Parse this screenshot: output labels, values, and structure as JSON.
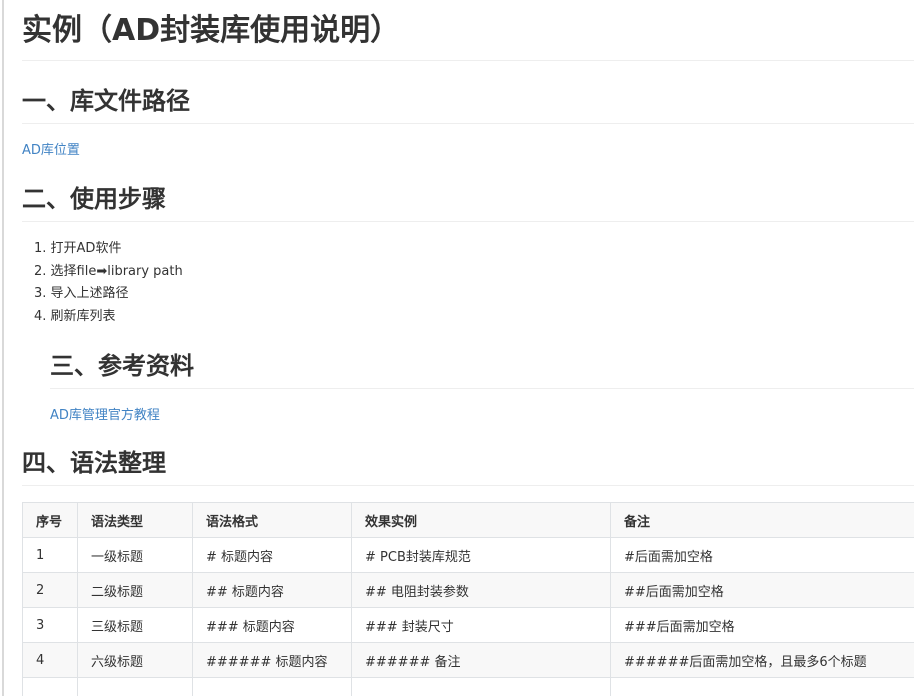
{
  "title": "实例（AD封装库使用说明）",
  "sections": [
    {
      "heading": "一、库文件路径",
      "link": "AD库位置"
    },
    {
      "heading": "二、使用步骤",
      "steps": [
        "1. 打开AD软件",
        "2. 选择file➡library path",
        "3. 导入上述路径",
        "4. 刷新库列表"
      ]
    },
    {
      "heading": "三、参考资料",
      "link": "AD库管理官方教程"
    },
    {
      "heading": "四、语法整理"
    }
  ],
  "table": {
    "headers": [
      "序号",
      "语法类型",
      "语法格式",
      "效果实例",
      "备注"
    ],
    "rows": [
      [
        "1",
        "一级标题",
        "# 标题内容",
        "# PCB封装库规范",
        "#后面需加空格"
      ],
      [
        "2",
        "二级标题",
        "## 标题内容",
        "## 电阻封装参数",
        "##后面需加空格"
      ],
      [
        "3",
        "三级标题",
        "### 标题内容",
        "### 封装尺寸",
        "###后面需加空格"
      ],
      [
        "4",
        "六级标题",
        "###### 标题内容",
        "###### 备注",
        "######后面需加空格，且最多6个标题"
      ]
    ]
  },
  "colors": {
    "link": "#4183c4",
    "text": "#333333",
    "table_border": "#dfe2e5",
    "table_stripe": "#f8f8f8"
  }
}
